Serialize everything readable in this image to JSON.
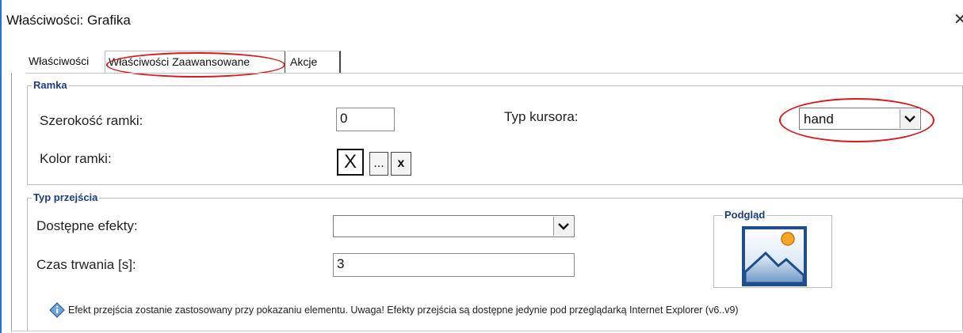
{
  "window": {
    "title": "Właściwości: Grafika",
    "close_icon": "close-icon"
  },
  "tabs": [
    {
      "label": "Właściwości"
    },
    {
      "label": "Właściwości Zaawansowane",
      "active": true,
      "highlighted": true
    },
    {
      "label": "Akcje"
    }
  ],
  "ramka": {
    "legend": "Ramka",
    "width_label": "Szerokość ramki:",
    "width_value": "0",
    "color_label": "Kolor ramki:",
    "color_swatch_text": "X",
    "color_pick_button": "...",
    "color_clear_button": "x",
    "cursor_label": "Typ kursora:",
    "cursor_value": "hand"
  },
  "przejscie": {
    "legend": "Typ przejścia",
    "effects_label": "Dostępne efekty:",
    "effects_value": "",
    "duration_label": "Czas trwania [s]:",
    "duration_value": "3",
    "preview_legend": "Podgląd",
    "preview_icon": "image-icon"
  },
  "info": {
    "icon": "info-diamond-icon",
    "text": "Efekt przejścia zostanie zastosowany przy pokazaniu elementu. Uwaga! Efekty przejścia są dostępne jedynie pod przeglądarką Internet Explorer (v6..v9)"
  },
  "colors": {
    "highlight_ellipse": "#e0161b",
    "legend_text": "#1a3a8a",
    "window_border": "#2a6fd6"
  }
}
